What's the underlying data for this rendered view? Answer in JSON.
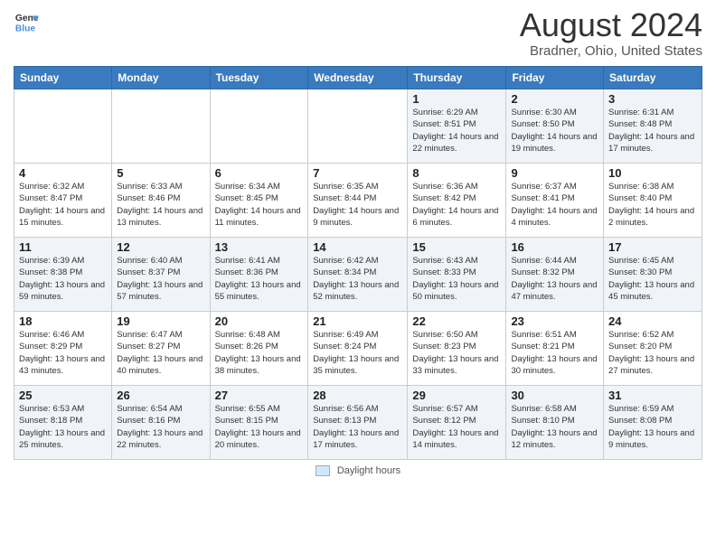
{
  "header": {
    "logo_general": "General",
    "logo_blue": "Blue",
    "month_title": "August 2024",
    "location": "Bradner, Ohio, United States"
  },
  "footer": {
    "legend_label": "Daylight hours"
  },
  "days_of_week": [
    "Sunday",
    "Monday",
    "Tuesday",
    "Wednesday",
    "Thursday",
    "Friday",
    "Saturday"
  ],
  "weeks": [
    [
      {
        "num": "",
        "info": ""
      },
      {
        "num": "",
        "info": ""
      },
      {
        "num": "",
        "info": ""
      },
      {
        "num": "",
        "info": ""
      },
      {
        "num": "1",
        "info": "Sunrise: 6:29 AM\nSunset: 8:51 PM\nDaylight: 14 hours\nand 22 minutes."
      },
      {
        "num": "2",
        "info": "Sunrise: 6:30 AM\nSunset: 8:50 PM\nDaylight: 14 hours\nand 19 minutes."
      },
      {
        "num": "3",
        "info": "Sunrise: 6:31 AM\nSunset: 8:48 PM\nDaylight: 14 hours\nand 17 minutes."
      }
    ],
    [
      {
        "num": "4",
        "info": "Sunrise: 6:32 AM\nSunset: 8:47 PM\nDaylight: 14 hours\nand 15 minutes."
      },
      {
        "num": "5",
        "info": "Sunrise: 6:33 AM\nSunset: 8:46 PM\nDaylight: 14 hours\nand 13 minutes."
      },
      {
        "num": "6",
        "info": "Sunrise: 6:34 AM\nSunset: 8:45 PM\nDaylight: 14 hours\nand 11 minutes."
      },
      {
        "num": "7",
        "info": "Sunrise: 6:35 AM\nSunset: 8:44 PM\nDaylight: 14 hours\nand 9 minutes."
      },
      {
        "num": "8",
        "info": "Sunrise: 6:36 AM\nSunset: 8:42 PM\nDaylight: 14 hours\nand 6 minutes."
      },
      {
        "num": "9",
        "info": "Sunrise: 6:37 AM\nSunset: 8:41 PM\nDaylight: 14 hours\nand 4 minutes."
      },
      {
        "num": "10",
        "info": "Sunrise: 6:38 AM\nSunset: 8:40 PM\nDaylight: 14 hours\nand 2 minutes."
      }
    ],
    [
      {
        "num": "11",
        "info": "Sunrise: 6:39 AM\nSunset: 8:38 PM\nDaylight: 13 hours\nand 59 minutes."
      },
      {
        "num": "12",
        "info": "Sunrise: 6:40 AM\nSunset: 8:37 PM\nDaylight: 13 hours\nand 57 minutes."
      },
      {
        "num": "13",
        "info": "Sunrise: 6:41 AM\nSunset: 8:36 PM\nDaylight: 13 hours\nand 55 minutes."
      },
      {
        "num": "14",
        "info": "Sunrise: 6:42 AM\nSunset: 8:34 PM\nDaylight: 13 hours\nand 52 minutes."
      },
      {
        "num": "15",
        "info": "Sunrise: 6:43 AM\nSunset: 8:33 PM\nDaylight: 13 hours\nand 50 minutes."
      },
      {
        "num": "16",
        "info": "Sunrise: 6:44 AM\nSunset: 8:32 PM\nDaylight: 13 hours\nand 47 minutes."
      },
      {
        "num": "17",
        "info": "Sunrise: 6:45 AM\nSunset: 8:30 PM\nDaylight: 13 hours\nand 45 minutes."
      }
    ],
    [
      {
        "num": "18",
        "info": "Sunrise: 6:46 AM\nSunset: 8:29 PM\nDaylight: 13 hours\nand 43 minutes."
      },
      {
        "num": "19",
        "info": "Sunrise: 6:47 AM\nSunset: 8:27 PM\nDaylight: 13 hours\nand 40 minutes."
      },
      {
        "num": "20",
        "info": "Sunrise: 6:48 AM\nSunset: 8:26 PM\nDaylight: 13 hours\nand 38 minutes."
      },
      {
        "num": "21",
        "info": "Sunrise: 6:49 AM\nSunset: 8:24 PM\nDaylight: 13 hours\nand 35 minutes."
      },
      {
        "num": "22",
        "info": "Sunrise: 6:50 AM\nSunset: 8:23 PM\nDaylight: 13 hours\nand 33 minutes."
      },
      {
        "num": "23",
        "info": "Sunrise: 6:51 AM\nSunset: 8:21 PM\nDaylight: 13 hours\nand 30 minutes."
      },
      {
        "num": "24",
        "info": "Sunrise: 6:52 AM\nSunset: 8:20 PM\nDaylight: 13 hours\nand 27 minutes."
      }
    ],
    [
      {
        "num": "25",
        "info": "Sunrise: 6:53 AM\nSunset: 8:18 PM\nDaylight: 13 hours\nand 25 minutes."
      },
      {
        "num": "26",
        "info": "Sunrise: 6:54 AM\nSunset: 8:16 PM\nDaylight: 13 hours\nand 22 minutes."
      },
      {
        "num": "27",
        "info": "Sunrise: 6:55 AM\nSunset: 8:15 PM\nDaylight: 13 hours\nand 20 minutes."
      },
      {
        "num": "28",
        "info": "Sunrise: 6:56 AM\nSunset: 8:13 PM\nDaylight: 13 hours\nand 17 minutes."
      },
      {
        "num": "29",
        "info": "Sunrise: 6:57 AM\nSunset: 8:12 PM\nDaylight: 13 hours\nand 14 minutes."
      },
      {
        "num": "30",
        "info": "Sunrise: 6:58 AM\nSunset: 8:10 PM\nDaylight: 13 hours\nand 12 minutes."
      },
      {
        "num": "31",
        "info": "Sunrise: 6:59 AM\nSunset: 8:08 PM\nDaylight: 13 hours\nand 9 minutes."
      }
    ]
  ]
}
